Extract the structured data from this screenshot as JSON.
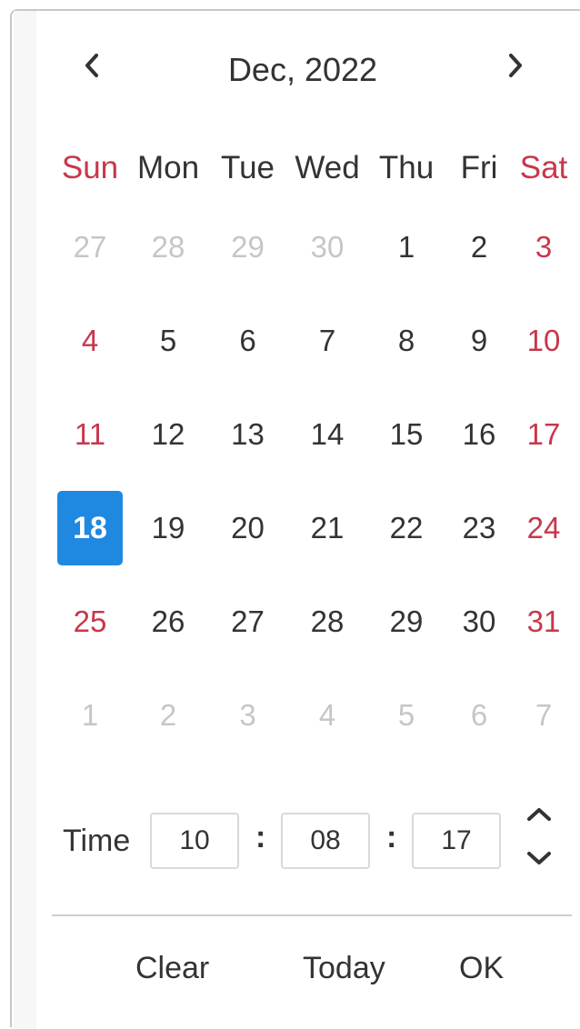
{
  "header": {
    "month_title": "Dec, 2022"
  },
  "weekdays": [
    "Sun",
    "Mon",
    "Tue",
    "Wed",
    "Thu",
    "Fri",
    "Sat"
  ],
  "weeks": [
    [
      "27",
      "28",
      "29",
      "30",
      "1",
      "2",
      "3"
    ],
    [
      "4",
      "5",
      "6",
      "7",
      "8",
      "9",
      "10"
    ],
    [
      "11",
      "12",
      "13",
      "14",
      "15",
      "16",
      "17"
    ],
    [
      "18",
      "19",
      "20",
      "21",
      "22",
      "23",
      "24"
    ],
    [
      "25",
      "26",
      "27",
      "28",
      "29",
      "30",
      "31"
    ],
    [
      "1",
      "2",
      "3",
      "4",
      "5",
      "6",
      "7"
    ]
  ],
  "selected_day": "18",
  "time": {
    "label": "Time",
    "hour": "10",
    "minute": "08",
    "second": "17",
    "separator": ":"
  },
  "footer": {
    "clear": "Clear",
    "today": "Today",
    "ok": "OK"
  },
  "colors": {
    "accent": "#1f88e0",
    "weekend": "#c8374b",
    "muted": "#c6c6c6"
  },
  "icons": {
    "prev": "chevron-left-icon",
    "next": "chevron-right-icon",
    "spin_up": "chevron-up-icon",
    "spin_down": "chevron-down-icon"
  }
}
